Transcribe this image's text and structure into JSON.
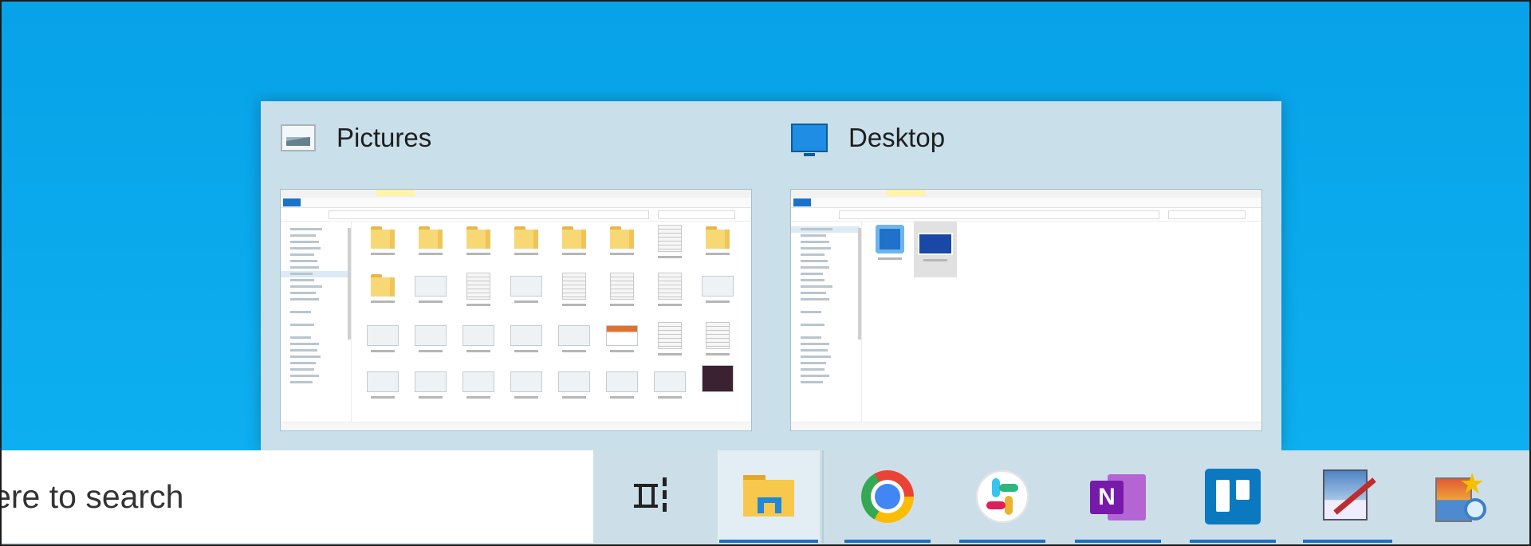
{
  "thumbnails": [
    {
      "title": "Pictures",
      "icon": "pictures-folder-icon"
    },
    {
      "title": "Desktop",
      "icon": "desktop-folder-icon"
    }
  ],
  "taskbar": {
    "search_text": "Type here to search",
    "buttons": [
      {
        "name": "task-view-icon",
        "active": false,
        "running": false
      },
      {
        "name": "file-explorer-icon",
        "active": true,
        "running": true
      },
      {
        "name": "chrome-icon",
        "active": false,
        "running": true
      },
      {
        "name": "slack-icon",
        "active": false,
        "running": true
      },
      {
        "name": "onenote-icon",
        "active": false,
        "running": true
      },
      {
        "name": "trello-icon",
        "active": false,
        "running": true
      },
      {
        "name": "paint-icon",
        "active": false,
        "running": true
      },
      {
        "name": "image-viewer-icon",
        "active": false,
        "running": false
      }
    ],
    "onenote_letter": "N"
  },
  "colors": {
    "desktop": "#0aa8ee",
    "taskbar": "#ccdfe9",
    "indicator": "#1f6fc4"
  }
}
